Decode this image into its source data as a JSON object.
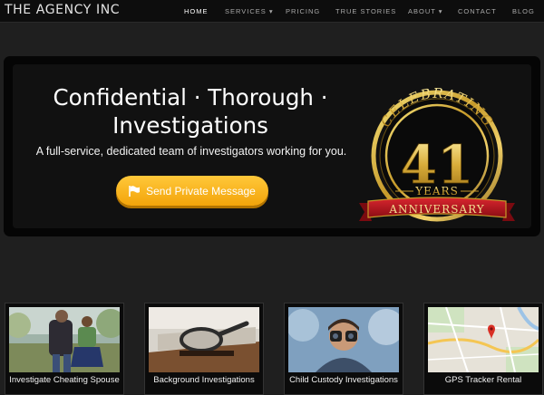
{
  "nav": {
    "brand": "THE AGENCY INC",
    "items": [
      {
        "label": "HOME",
        "active": true
      },
      {
        "label": "SERVICES ▾"
      },
      {
        "label": "PRICING"
      },
      {
        "label": "TRUE STORIES"
      },
      {
        "label": "ABOUT ▾"
      },
      {
        "label": "CONTACT"
      },
      {
        "label": "BLOG"
      }
    ]
  },
  "hero": {
    "title_line1": "Confidential · Thorough ·",
    "title_line2": "Investigations",
    "subtitle": "A full-service, dedicated team of investigators working for you.",
    "cta_label": "Send Private Message",
    "cta_icon": "flag-icon"
  },
  "badge": {
    "top_text": "CELEBRATING",
    "number": "41",
    "years": "YEARS",
    "ribbon": "ANNIVERSARY"
  },
  "services": [
    {
      "label": "Investigate Cheating Spouse",
      "image": "couple-photo"
    },
    {
      "label": "Background Investigations",
      "image": "magnifying-glass-photo"
    },
    {
      "label": "Child Custody Investigations",
      "image": "child-binoculars-photo"
    },
    {
      "label": "GPS Tracker Rental",
      "image": "map-photo"
    }
  ],
  "colors": {
    "background": "#1f1f1f",
    "nav_background": "#0d0d0d",
    "cta": "#f5a623",
    "gold": "#c9a233",
    "ribbon_red": "#b5121b"
  }
}
